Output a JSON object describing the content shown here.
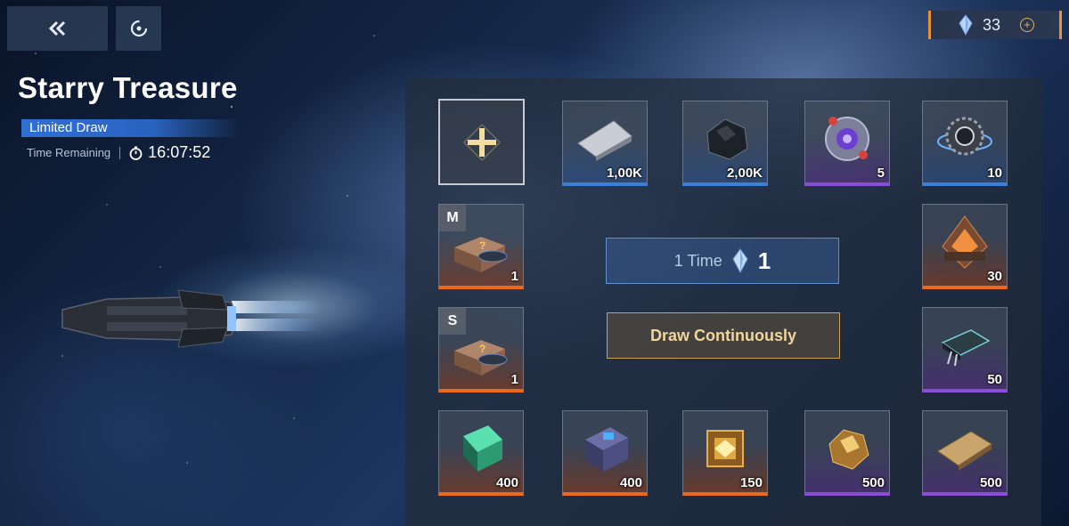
{
  "header": {
    "back_icon": "double-chevron-left-icon",
    "refresh_icon": "refresh-icon",
    "currency": {
      "icon": "crystal-icon",
      "amount": "33",
      "add_icon": "plus-icon"
    }
  },
  "event": {
    "title": "Starry Treasure",
    "badge": "Limited Draw",
    "time_label": "Time Remaining",
    "timer_icon": "stopwatch-icon",
    "time_value": "16:07:52"
  },
  "board": {
    "add_slot_icon": "plus-icon",
    "slots": [
      {
        "name": "alloy-plate",
        "qty": "1,00K",
        "rarity": "blue"
      },
      {
        "name": "dark-ore",
        "qty": "2,00K",
        "rarity": "blue"
      },
      {
        "name": "core-sphere",
        "qty": "5",
        "rarity": "purple"
      },
      {
        "name": "gear-module",
        "qty": "10",
        "rarity": "blue"
      },
      {
        "name": "supply-crate-m",
        "qty": "1",
        "rarity": "orange",
        "tag": "M"
      },
      {
        "name": "engine-block",
        "qty": "30",
        "rarity": "orange"
      },
      {
        "name": "supply-crate-s",
        "qty": "1",
        "rarity": "orange",
        "tag": "S"
      },
      {
        "name": "chip-module",
        "qty": "50",
        "rarity": "purple"
      },
      {
        "name": "green-crystal-block",
        "qty": "400",
        "rarity": "orange"
      },
      {
        "name": "blueprint-cube",
        "qty": "400",
        "rarity": "orange"
      },
      {
        "name": "gold-cube",
        "qty": "150",
        "rarity": "orange"
      },
      {
        "name": "gold-nugget",
        "qty": "500",
        "rarity": "purple"
      },
      {
        "name": "gold-plate",
        "qty": "500",
        "rarity": "purple"
      }
    ]
  },
  "actions": {
    "one_time_label": "1 Time",
    "one_time_cost": "1",
    "one_time_cost_icon": "crystal-icon",
    "draw_continuously_label": "Draw Continuously"
  },
  "colors": {
    "accent_orange": "#e86a1c",
    "rarity_blue": "#3d7fd6",
    "rarity_purple": "#8a4ed6",
    "badge_blue": "#2f6fd6"
  }
}
